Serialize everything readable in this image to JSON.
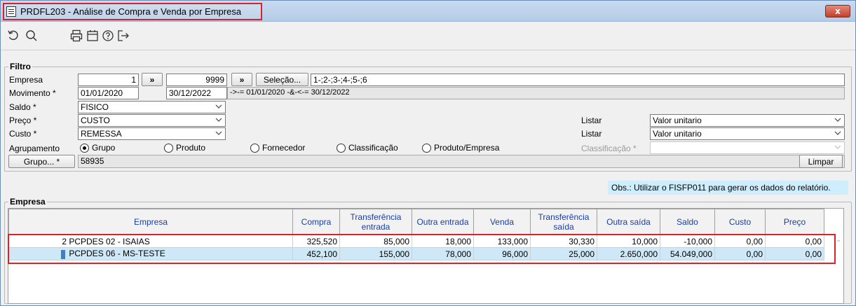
{
  "window": {
    "title": "PRDFL203 - Análise de Compra e Venda por Empresa",
    "close_label": "x"
  },
  "toolbar": {
    "icons": [
      "undo-icon",
      "search-icon",
      "print-icon",
      "calendar-icon",
      "help-icon",
      "exit-icon"
    ]
  },
  "filtro": {
    "group_label": "Filtro",
    "empresa": {
      "label": "Empresa",
      "from": "1",
      "to": "9999",
      "arrow": "»",
      "selecao_label": "Seleção...",
      "selecao_value": "1-;2-;3-;4-;5-;6"
    },
    "movimento": {
      "label": "Movimento *",
      "from": "01/01/2020",
      "to": "30/12/2022",
      "desc": "->-= 01/01/2020 -&-<-= 30/12/2022"
    },
    "saldo": {
      "label": "Saldo *",
      "value": "FISICO"
    },
    "preco": {
      "label": "Preço *",
      "value": "CUSTO"
    },
    "custo": {
      "label": "Custo *",
      "value": "REMESSA"
    },
    "listar1": {
      "label": "Listar",
      "value": "Valor unitario"
    },
    "listar2": {
      "label": "Listar",
      "value": "Valor unitario"
    },
    "agrupamento": {
      "label": "Agrupamento",
      "options": [
        "Grupo",
        "Produto",
        "Fornecedor",
        "Classificação",
        "Produto/Empresa"
      ],
      "selected": "Grupo"
    },
    "classificacao": {
      "label": "Classificação *",
      "value": ""
    },
    "grupo": {
      "button_label": "Grupo... *",
      "value": "58935"
    },
    "limpar_label": "Limpar"
  },
  "obs_text": "Obs.: Utilizar o FISFP011 para gerar os dados do relatório.",
  "empresa_grid": {
    "group_label": "Empresa",
    "columns": [
      "Empresa",
      "Compra",
      "Transferência entrada",
      "Outra entrada",
      "Venda",
      "Transferência saída",
      "Outra saída",
      "Saldo",
      "Custo",
      "Preço"
    ],
    "rows": [
      {
        "code": "2",
        "name": "PCPDES 02 - ISAIAS",
        "compra": "325,520",
        "transf_entrada": "85,000",
        "outra_entrada": "18,000",
        "venda": "133,000",
        "transf_saida": "30,330",
        "outra_saida": "10,000",
        "saldo": "-10,000",
        "custo": "0,00",
        "preco": "0,00"
      },
      {
        "code": "",
        "name": "PCPDES 06 - MS-TESTE",
        "compra": "452,100",
        "transf_entrada": "155,000",
        "outra_entrada": "78,000",
        "venda": "96,000",
        "transf_saida": "25,000",
        "outra_saida": "2.650,000",
        "saldo": "54.049,000",
        "custo": "0,00",
        "preco": "0,00"
      }
    ]
  }
}
